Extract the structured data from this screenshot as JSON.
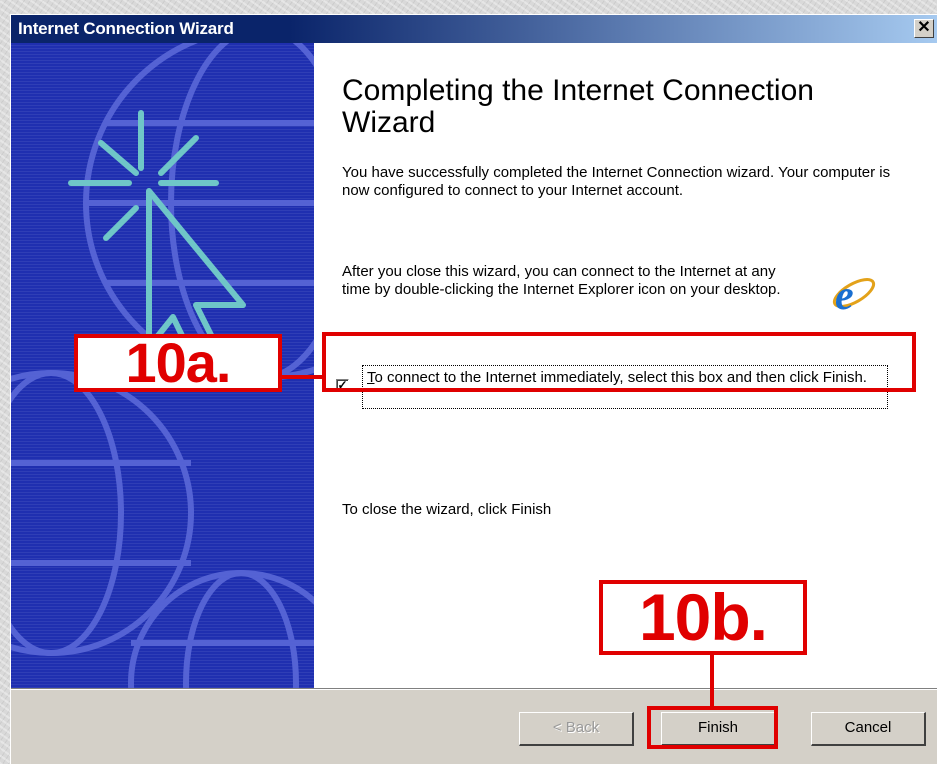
{
  "window": {
    "title": "Internet Connection Wizard",
    "close_glyph": "✕"
  },
  "content": {
    "heading": "Completing the Internet Connection Wizard",
    "success_text": "You have successfully completed the Internet Connection wizard. Your computer is now configured to connect to your Internet account.",
    "after_close_text": "After you close this wizard, you can connect to the Internet at any time by double-clicking the Internet Explorer icon on your desktop.",
    "checkbox": {
      "checked": true,
      "mark": "✓",
      "label_access_key": "T",
      "label_rest": "o connect to the Internet immediately, select this box and then click Finish."
    },
    "close_hint": "To close the wizard, click Finish",
    "icon": "internet-explorer-icon"
  },
  "annotations": {
    "step_a": "10a.",
    "step_b": "10b."
  },
  "buttons": {
    "back": "< Back",
    "finish": "Finish",
    "cancel": "Cancel"
  },
  "colors": {
    "title_bar": "#0a246a",
    "side_panel": "#1f2fb0",
    "annotation_red": "#e00000"
  }
}
